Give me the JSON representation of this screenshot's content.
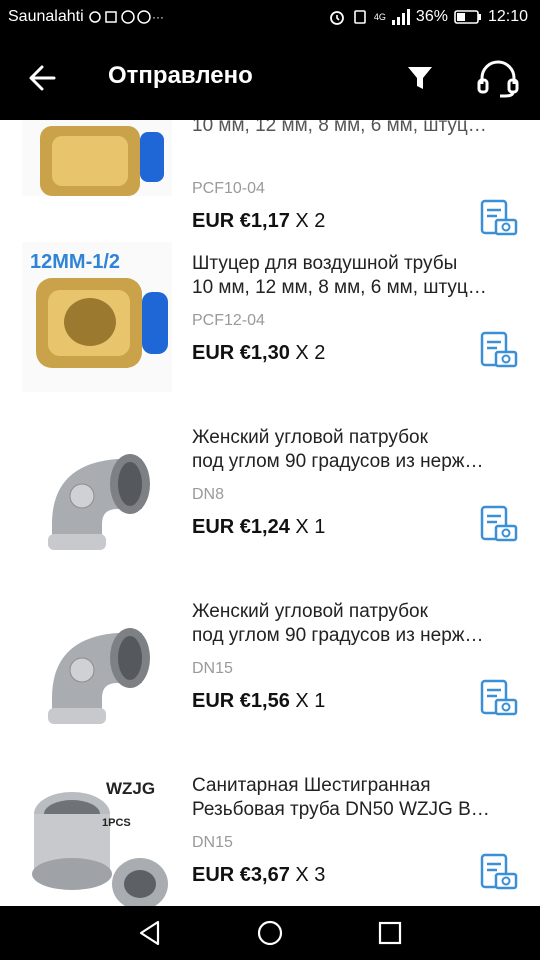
{
  "status": {
    "carrier": "Saunalahti",
    "network": "4G",
    "battery": "36%",
    "time": "12:10"
  },
  "appbar": {
    "title": "Отправлено"
  },
  "items": [
    {
      "title_line1": "10 мм, 12 мм, 8 мм, 6 мм, штуц…",
      "title_line2": "",
      "sku": "PCF10-04",
      "price": "EUR €1,17",
      "qty": "X 2"
    },
    {
      "thumb_label": "12MM-1/2",
      "title_line1": "Штуцер для воздушной трубы",
      "title_line2": "10 мм, 12 мм, 8 мм, 6 мм, штуц…",
      "sku": "PCF12-04",
      "price": "EUR €1,30",
      "qty": "X 2"
    },
    {
      "title_line1": "Женский угловой патрубок",
      "title_line2": "под углом 90 градусов из нерж…",
      "sku": "DN8",
      "price": "EUR €1,24",
      "qty": "X 1"
    },
    {
      "title_line1": "Женский угловой патрубок",
      "title_line2": "под углом 90 градусов из нерж…",
      "sku": "DN15",
      "price": "EUR €1,56",
      "qty": "X 1"
    },
    {
      "thumb_label": "WZJG",
      "thumb_sub": "1PCS",
      "title_line1": "Санитарная Шестигранная",
      "title_line2": "Резьбовая труба DN50 WZJG B…",
      "sku": "DN15",
      "price": "EUR €3,67",
      "qty": "X 3"
    }
  ]
}
